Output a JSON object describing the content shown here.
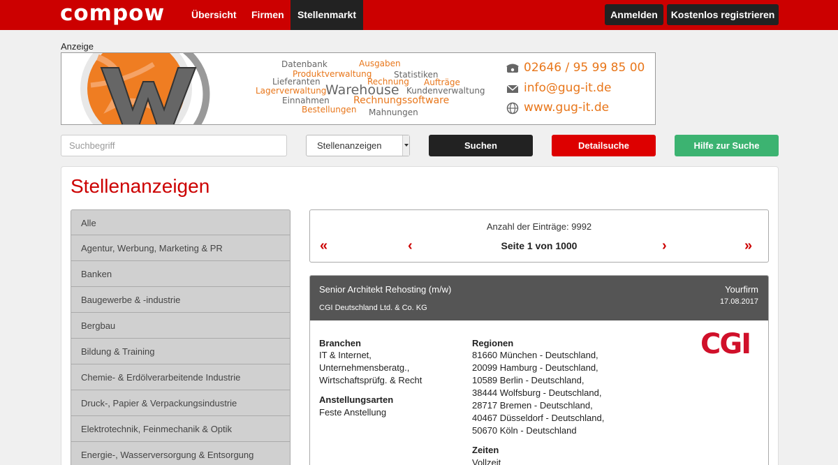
{
  "nav": {
    "logo": "compow",
    "items": [
      "Übersicht",
      "Firmen",
      "Stellenmarkt"
    ],
    "login": "Anmelden",
    "register": "Kostenlos registrieren"
  },
  "ad": {
    "label": "Anzeige",
    "cloud": [
      "Datenbank",
      "Ausgaben",
      "Produktverwaltung",
      "Statistiken",
      "Lieferanten",
      "Rechnung",
      "Aufträge",
      "Lagerverwaltung",
      "Warehouse",
      "Kundenverwaltung",
      "Einnahmen",
      "Rechnungssoftware",
      "Bestellungen",
      "Mahnungen"
    ],
    "phone": "02646 / 95 99 85 00",
    "email": "info@gug-it.de",
    "web": "www.gug-it.de"
  },
  "search": {
    "placeholder": "Suchbegriff",
    "select": "Stellenanzeigen",
    "search_btn": "Suchen",
    "detail_btn": "Detailsuche",
    "help_btn": "Hilfe zur Suche"
  },
  "page_title": "Stellenanzeigen",
  "categories": [
    "Alle",
    "Agentur, Werbung, Marketing & PR",
    "Banken",
    "Baugewerbe & -industrie",
    "Bergbau",
    "Bildung & Training",
    "Chemie- & Erdölverarbeitende Industrie",
    "Druck-, Papier & Verpackungsindustrie",
    "Elektrotechnik, Feinmechanik & Optik",
    "Energie-, Wasserversorgung & Entsorgung"
  ],
  "pager": {
    "count": "Anzahl der Einträge: 9992",
    "page": "Seite 1 von 1000"
  },
  "job": {
    "title": "Senior Architekt Rehosting (m/w)",
    "company": "CGI Deutschland Ltd. & Co. KG",
    "source": "Yourfirm",
    "date": "17.08.2017",
    "branchen_label": "Branchen",
    "branchen": [
      "IT & Internet,",
      "Unternehmensberatg.,",
      "Wirtschaftsprüfg. & Recht"
    ],
    "anstellung_label": "Anstellungsarten",
    "anstellung": "Feste Anstellung",
    "regionen_label": "Regionen",
    "regionen": [
      "81660 München - Deutschland,",
      "20099 Hamburg - Deutschland,",
      "10589 Berlin - Deutschland,",
      "38444 Wolfsburg - Deutschland,",
      "28717 Bremen - Deutschland,",
      "40467 Düsseldorf - Deutschland,",
      "50670 Köln - Deutschland"
    ],
    "zeiten_label": "Zeiten",
    "zeiten": "Vollzeit",
    "logo_text": "CGI"
  },
  "colors": {
    "brand_red": "#cc0000",
    "dark": "#222222",
    "help_green": "#3cb371",
    "ad_orange": "#e8761a"
  }
}
